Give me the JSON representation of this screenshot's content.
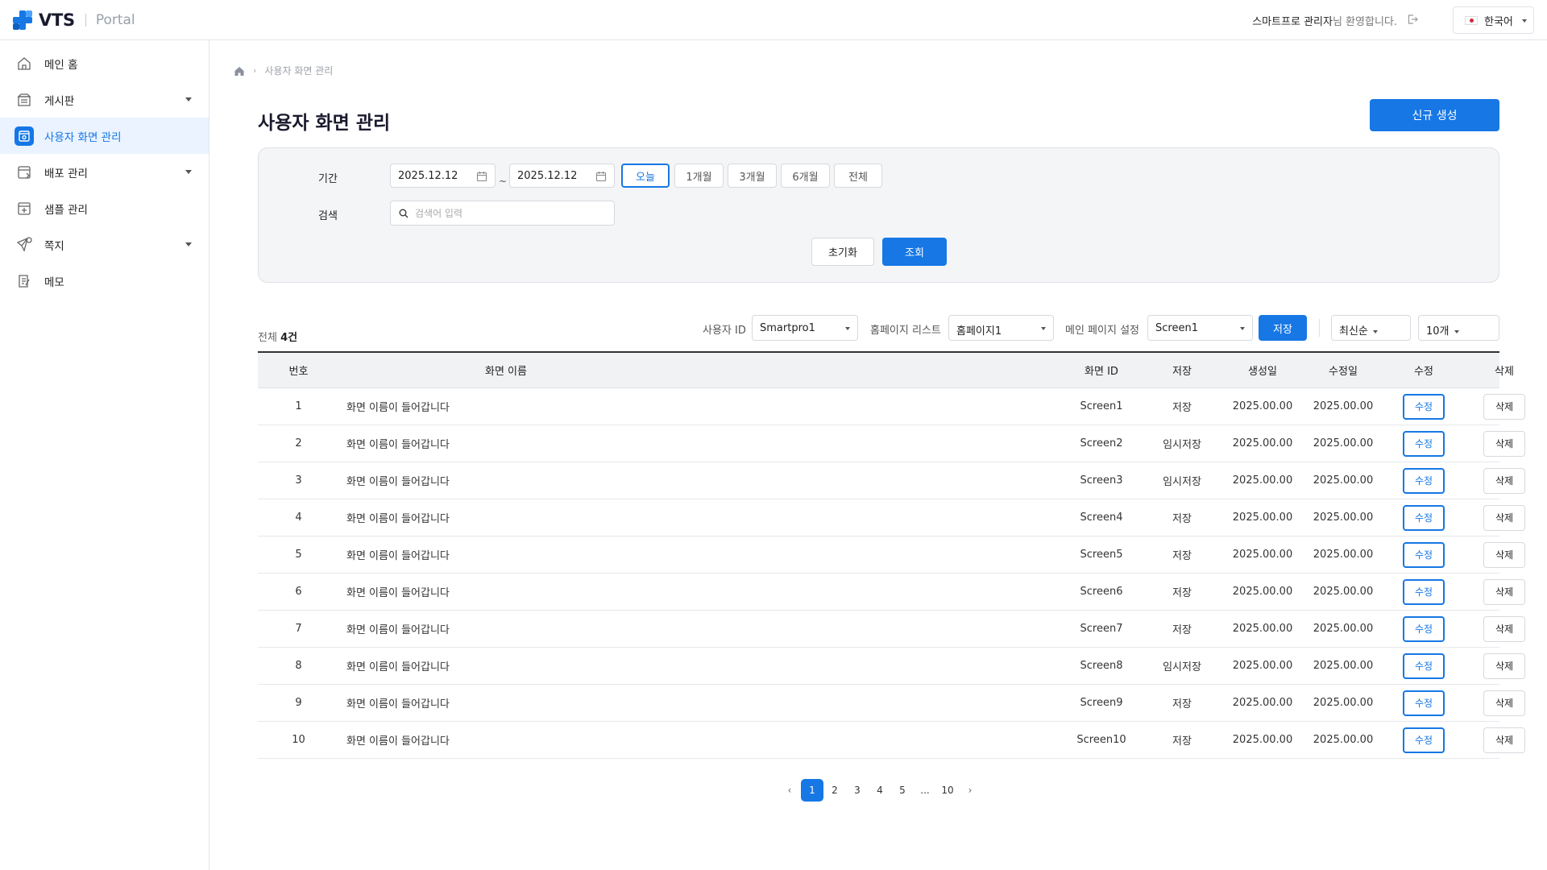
{
  "header": {
    "logo_text": "VTS",
    "logo_sub": "Portal",
    "welcome_name": "스마트프로 관리자",
    "welcome_suffix": "님 환영합니다.",
    "language": "한국어"
  },
  "sidebar": {
    "items": [
      {
        "label": "메인 홈",
        "icon": "home-icon",
        "expandable": false
      },
      {
        "label": "게시판",
        "icon": "board-icon",
        "expandable": true
      },
      {
        "label": "사용자 화면 관리",
        "icon": "screen-icon",
        "expandable": false,
        "active": true
      },
      {
        "label": "배포 관리",
        "icon": "deploy-icon",
        "expandable": true
      },
      {
        "label": "샘플 관리",
        "icon": "sample-icon",
        "expandable": false
      },
      {
        "label": "쪽지",
        "icon": "message-icon",
        "expandable": true
      },
      {
        "label": "메모",
        "icon": "memo-icon",
        "expandable": false
      }
    ]
  },
  "breadcrumb": {
    "current": "사용자 화면 관리"
  },
  "page": {
    "title": "사용자 화면 관리",
    "new_button": "신규 생성"
  },
  "filter": {
    "period_label": "기간",
    "date_from": "2025.12.12",
    "date_to": "2025.12.12",
    "tilde": "~",
    "period_options": [
      "오늘",
      "1개월",
      "3개월",
      "6개월",
      "전체"
    ],
    "period_selected": "오늘",
    "search_label": "검색",
    "search_placeholder": "검색어 입력",
    "reset_button": "초기화",
    "query_button": "조회"
  },
  "toolbar": {
    "total_prefix": "전체",
    "total_count": "4건",
    "user_id_label": "사용자 ID",
    "user_id_value": "Smartpro1",
    "homepage_label": "홈페이지 리스트",
    "homepage_value": "홈페이지1",
    "mainpage_label": "메인 페이지 설정",
    "mainpage_value": "Screen1",
    "save_button": "저장",
    "sort_value": "최신순",
    "page_size_value": "10개"
  },
  "table": {
    "columns": [
      "번호",
      "화면 이름",
      "화면 ID",
      "저장",
      "생성일",
      "수정일",
      "수정",
      "삭제"
    ],
    "edit_label": "수정",
    "delete_label": "삭제",
    "rows": [
      {
        "no": "1",
        "name": "화면 이름이 들어갑니다",
        "id": "Screen1",
        "save": "저장",
        "created": "2025.00.00",
        "modified": "2025.00.00"
      },
      {
        "no": "2",
        "name": "화면 이름이 들어갑니다",
        "id": "Screen2",
        "save": "임시저장",
        "created": "2025.00.00",
        "modified": "2025.00.00"
      },
      {
        "no": "3",
        "name": "화면 이름이 들어갑니다",
        "id": "Screen3",
        "save": "임시저장",
        "created": "2025.00.00",
        "modified": "2025.00.00"
      },
      {
        "no": "4",
        "name": "화면 이름이 들어갑니다",
        "id": "Screen4",
        "save": "저장",
        "created": "2025.00.00",
        "modified": "2025.00.00"
      },
      {
        "no": "5",
        "name": "화면 이름이 들어갑니다",
        "id": "Screen5",
        "save": "저장",
        "created": "2025.00.00",
        "modified": "2025.00.00"
      },
      {
        "no": "6",
        "name": "화면 이름이 들어갑니다",
        "id": "Screen6",
        "save": "저장",
        "created": "2025.00.00",
        "modified": "2025.00.00"
      },
      {
        "no": "7",
        "name": "화면 이름이 들어갑니다",
        "id": "Screen7",
        "save": "저장",
        "created": "2025.00.00",
        "modified": "2025.00.00"
      },
      {
        "no": "8",
        "name": "화면 이름이 들어갑니다",
        "id": "Screen8",
        "save": "임시저장",
        "created": "2025.00.00",
        "modified": "2025.00.00"
      },
      {
        "no": "9",
        "name": "화면 이름이 들어갑니다",
        "id": "Screen9",
        "save": "저장",
        "created": "2025.00.00",
        "modified": "2025.00.00"
      },
      {
        "no": "10",
        "name": "화면 이름이 들어갑니다",
        "id": "Screen10",
        "save": "저장",
        "created": "2025.00.00",
        "modified": "2025.00.00"
      }
    ]
  },
  "pagination": {
    "pages": [
      "1",
      "2",
      "3",
      "4",
      "5",
      "...",
      "10"
    ],
    "current": "1",
    "prev": "‹",
    "next": "›"
  },
  "colors": {
    "accent": "#1677e5",
    "active_nav_bg": "#eaf3ff",
    "filter_bg": "#f4f5f7"
  }
}
